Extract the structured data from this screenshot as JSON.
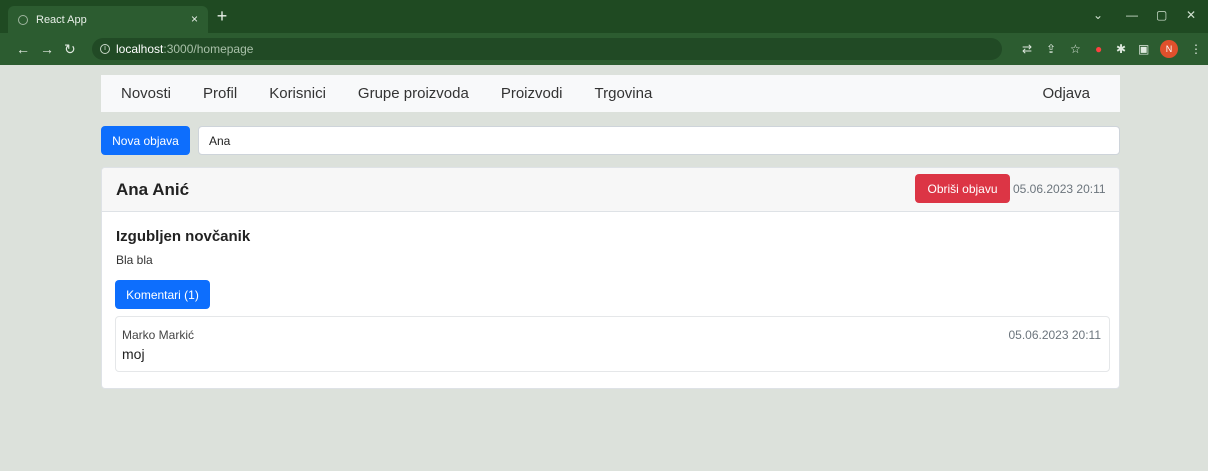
{
  "browser": {
    "tab_title": "React App",
    "tab_close": "×",
    "new_tab": "+",
    "url_host": "localhost",
    "url_path": ":3000/homepage",
    "profile_initial": "N",
    "window_controls": {
      "minimize": "—",
      "restore": "▢",
      "close": "✕",
      "dropdown": "⌄"
    }
  },
  "navbar": {
    "items": [
      "Novosti",
      "Profil",
      "Korisnici",
      "Grupe proizvoda",
      "Proizvodi",
      "Trgovina"
    ],
    "logout": "Odjava"
  },
  "new_post": {
    "button_label": "Nova objava",
    "input_value": "Ana"
  },
  "post": {
    "author": "Ana Anić",
    "delete_label": "Obriši objavu",
    "date": "05.06.2023 20:11",
    "title": "Izgubljen novčanik",
    "body": "Bla bla",
    "comments_label": "Komentari (1)",
    "comments": [
      {
        "author": "Marko Markić",
        "date": "05.06.2023 20:11",
        "text": "moj"
      }
    ]
  },
  "colors": {
    "primary": "#0d6efd",
    "danger": "#dc3545",
    "browser_frame": "#1f4a22",
    "page_background": "#dce1db"
  }
}
